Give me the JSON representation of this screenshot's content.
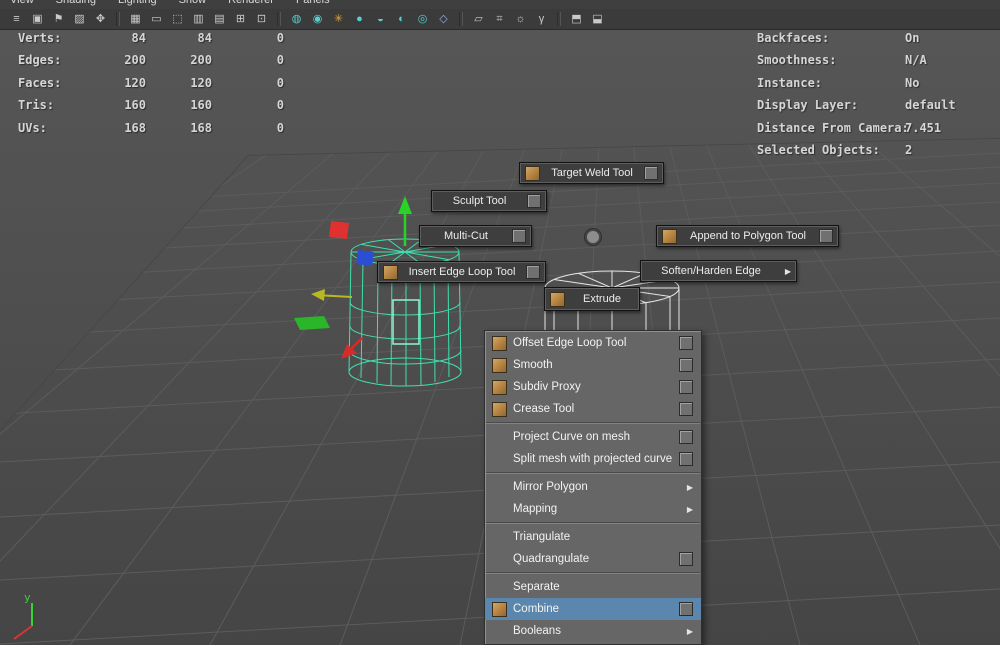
{
  "menubar": {
    "items": [
      "View",
      "Shading",
      "Lighting",
      "Show",
      "Renderer",
      "Panels"
    ]
  },
  "toolbar": {
    "icons": [
      {
        "name": "panel-menu-icon",
        "glyph": "≡"
      },
      {
        "name": "camera-attrs-icon",
        "glyph": "▣"
      },
      {
        "name": "bookmark-icon",
        "glyph": "⚑"
      },
      {
        "name": "image-plane-icon",
        "glyph": "▨"
      },
      {
        "name": "pan-zoom-icon",
        "glyph": "✥"
      },
      {
        "name": "grid-toggle-icon",
        "glyph": "▦"
      },
      {
        "name": "film-gate-icon",
        "glyph": "▭"
      },
      {
        "name": "resolution-gate-icon",
        "glyph": "⬚"
      },
      {
        "name": "gate-mask-icon",
        "glyph": "▥"
      },
      {
        "name": "field-chart-icon",
        "glyph": "▤"
      },
      {
        "name": "safe-action-icon",
        "glyph": "⊞"
      },
      {
        "name": "safe-title-icon",
        "glyph": "⊡"
      },
      {
        "name": "shaded-mode-icon",
        "glyph": "◍"
      },
      {
        "name": "textured-mode-icon",
        "glyph": "◉"
      },
      {
        "name": "lighting-icon",
        "glyph": "✳"
      },
      {
        "name": "shadows-icon",
        "glyph": "●"
      },
      {
        "name": "ambient-occlusion-icon",
        "glyph": "◒"
      },
      {
        "name": "motion-blur-icon",
        "glyph": "◐"
      },
      {
        "name": "depth-of-field-icon",
        "glyph": "◎"
      },
      {
        "name": "isolate-select-icon",
        "glyph": "◇"
      },
      {
        "name": "xray-icon",
        "glyph": "▱"
      },
      {
        "name": "xray-joints-icon",
        "glyph": "⌗"
      },
      {
        "name": "exposure-icon",
        "glyph": "☼"
      },
      {
        "name": "gamma-icon",
        "glyph": "γ"
      },
      {
        "name": "snapshot-icon",
        "glyph": "⬒"
      },
      {
        "name": "multisample-icon",
        "glyph": "⬓"
      }
    ]
  },
  "hud": {
    "left": {
      "rows": [
        {
          "label": "Verts:",
          "c1": "84",
          "c2": "84",
          "c3": "0"
        },
        {
          "label": "Edges:",
          "c1": "200",
          "c2": "200",
          "c3": "0"
        },
        {
          "label": "Faces:",
          "c1": "120",
          "c2": "120",
          "c3": "0"
        },
        {
          "label": "Tris:",
          "c1": "160",
          "c2": "160",
          "c3": "0"
        },
        {
          "label": "UVs:",
          "c1": "168",
          "c2": "168",
          "c3": "0"
        }
      ]
    },
    "right": {
      "rows": [
        {
          "label": "Backfaces:",
          "value": "On"
        },
        {
          "label": "Smoothness:",
          "value": "N/A"
        },
        {
          "label": "Instance:",
          "value": "No"
        },
        {
          "label": "Display Layer:",
          "value": "default"
        },
        {
          "label": "Distance From Camera:",
          "value": "7.451"
        },
        {
          "label": "Selected Objects:",
          "value": "2"
        }
      ]
    }
  },
  "marking_menu": {
    "items": [
      {
        "label": "Target Weld Tool"
      },
      {
        "label": "Sculpt Tool"
      },
      {
        "label": "Multi-Cut"
      },
      {
        "label": "Append to Polygon Tool"
      },
      {
        "label": "Insert Edge Loop Tool"
      },
      {
        "label": "Soften/Harden Edge"
      },
      {
        "label": "Extrude"
      }
    ]
  },
  "context_menu": {
    "items": [
      {
        "label": "Offset Edge Loop Tool"
      },
      {
        "label": "Smooth"
      },
      {
        "label": "Subdiv Proxy"
      },
      {
        "label": "Crease Tool"
      },
      {
        "label": "Project Curve on mesh"
      },
      {
        "label": "Split mesh with projected curve"
      },
      {
        "label": "Mirror Polygon"
      },
      {
        "label": "Mapping"
      },
      {
        "label": "Triangulate"
      },
      {
        "label": "Quadrangulate"
      },
      {
        "label": "Separate"
      },
      {
        "label": "Combine"
      },
      {
        "label": "Booleans"
      }
    ]
  },
  "axis": {
    "y_label": "y"
  },
  "colors": {
    "viewport_bg": "#4f4f4f",
    "toolbar_bg": "#3b3b3b",
    "menu_bg": "#666666",
    "menu_highlight": "#5b87ae",
    "selected_wireframe": "#3fe0ae",
    "unselected_wireframe": "#e6e6e6",
    "manip_x": "#e03131",
    "manip_y": "#29d129",
    "manip_z": "#2b4fd4",
    "manip_plane_green": "#2ab52a",
    "manip_yellow": "#b8b825"
  }
}
